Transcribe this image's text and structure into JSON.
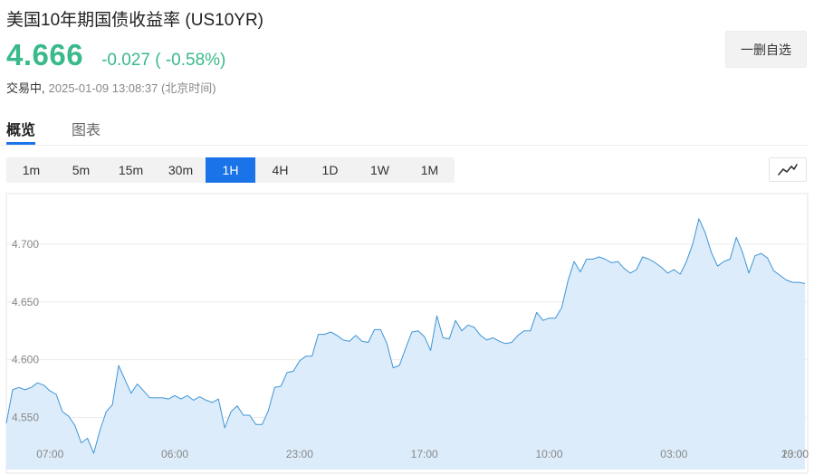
{
  "header": {
    "title": "美国10年期国债收益率  (US10YR)",
    "price": "4.666",
    "change": "-0.027 ( -0.58%)",
    "status": "交易中,",
    "timestamp": "2025-01-09 13:08:37 (北京时间)",
    "watchlist_button": "一删自选"
  },
  "tabs": [
    {
      "label": "概览",
      "active": true
    },
    {
      "label": "图表",
      "active": false
    }
  ],
  "intervals": [
    {
      "label": "1m",
      "active": false
    },
    {
      "label": "5m",
      "active": false
    },
    {
      "label": "15m",
      "active": false
    },
    {
      "label": "30m",
      "active": false
    },
    {
      "label": "1H",
      "active": true
    },
    {
      "label": "4H",
      "active": false
    },
    {
      "label": "1D",
      "active": false
    },
    {
      "label": "1W",
      "active": false
    },
    {
      "label": "1M",
      "active": false
    }
  ],
  "colors": {
    "accent": "#1a73e8",
    "price_change": "#3ab98a",
    "line": "#3f95d6",
    "area_fill": "#dcecfb"
  },
  "chart_type_icon": "line-chart-icon",
  "chart_data": {
    "type": "area",
    "title": "",
    "xlabel": "",
    "ylabel": "",
    "ylim": [
      4.505,
      4.743
    ],
    "y_ticks": [
      {
        "value": 4.55,
        "label": "4.550"
      },
      {
        "value": 4.6,
        "label": "4.600"
      },
      {
        "value": 4.65,
        "label": "4.650"
      },
      {
        "value": 4.7,
        "label": "4.700"
      }
    ],
    "x_ticks": [
      {
        "index": 7,
        "label": "07:00"
      },
      {
        "index": 27,
        "label": "06:00"
      },
      {
        "index": 47,
        "label": "23:00"
      },
      {
        "index": 67,
        "label": "17:00"
      },
      {
        "index": 87,
        "label": "10:00"
      },
      {
        "index": 107,
        "label": "03:00"
      },
      {
        "index": 127,
        "label": "20:00"
      },
      {
        "index": 147,
        "label": "13:00"
      }
    ],
    "grid": true,
    "series": [
      {
        "values": [
          4.545,
          4.574,
          4.576,
          4.574,
          4.576,
          4.58,
          4.578,
          4.573,
          4.57,
          4.555,
          4.551,
          4.543,
          4.528,
          4.532,
          4.519,
          4.539,
          4.555,
          4.561,
          4.595,
          4.583,
          4.571,
          4.579,
          4.573,
          4.567,
          4.567,
          4.567,
          4.566,
          4.569,
          4.566,
          4.569,
          4.565,
          4.568,
          4.565,
          4.563,
          4.566,
          4.541,
          4.555,
          4.56,
          4.552,
          4.552,
          4.544,
          4.544,
          4.556,
          4.576,
          4.577,
          4.589,
          4.59,
          4.599,
          4.603,
          4.603,
          4.622,
          4.622,
          4.624,
          4.621,
          4.617,
          4.616,
          4.621,
          4.616,
          4.615,
          4.626,
          4.626,
          4.614,
          4.593,
          4.595,
          4.61,
          4.624,
          4.625,
          4.62,
          4.608,
          4.638,
          4.619,
          4.618,
          4.634,
          4.625,
          4.63,
          4.628,
          4.621,
          4.617,
          4.619,
          4.616,
          4.614,
          4.615,
          4.621,
          4.625,
          4.625,
          4.641,
          4.634,
          4.636,
          4.636,
          4.645,
          4.668,
          4.685,
          4.676,
          4.687,
          4.687,
          4.689,
          4.687,
          4.684,
          4.685,
          4.679,
          4.675,
          4.678,
          4.689,
          4.687,
          4.684,
          4.68,
          4.675,
          4.678,
          4.674,
          4.685,
          4.7,
          4.722,
          4.71,
          4.693,
          4.681,
          4.685,
          4.687,
          4.706,
          4.693,
          4.675,
          4.69,
          4.692,
          4.688,
          4.677,
          4.673,
          4.669,
          4.667,
          4.667,
          4.666
        ]
      }
    ]
  }
}
